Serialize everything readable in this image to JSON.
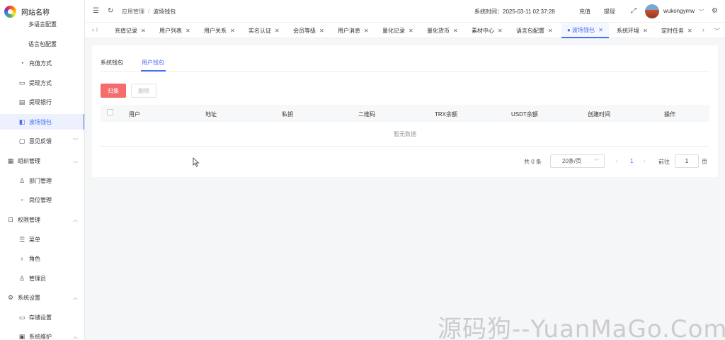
{
  "logo": {
    "text": "网站名称"
  },
  "sidebar": {
    "items": [
      {
        "label": "多语言配置"
      },
      {
        "label": "语言包配置"
      },
      {
        "label": "充值方式"
      },
      {
        "label": "提现方式"
      },
      {
        "label": "提现银行"
      },
      {
        "label": "波场钱包"
      },
      {
        "label": "意见反馈"
      },
      {
        "label": "组织管理"
      },
      {
        "label": "部门管理"
      },
      {
        "label": "岗位管理"
      },
      {
        "label": "权限管理"
      },
      {
        "label": "菜单"
      },
      {
        "label": "角色"
      },
      {
        "label": "管理员"
      },
      {
        "label": "系统设置"
      },
      {
        "label": "存储设置"
      },
      {
        "label": "系统维护"
      }
    ]
  },
  "header": {
    "breadcrumb": [
      "应用管理",
      "波场钱包"
    ],
    "system_time": "系统时间：2025-03-11 02:37:28",
    "recharge_label": "充值",
    "withdraw_label": "提现",
    "username": "wukongymw"
  },
  "tabs": [
    {
      "label": "充值记录"
    },
    {
      "label": "用户列表"
    },
    {
      "label": "用户关系"
    },
    {
      "label": "实名认证"
    },
    {
      "label": "会员等级"
    },
    {
      "label": "用户消息"
    },
    {
      "label": "量化记录"
    },
    {
      "label": "量化货币"
    },
    {
      "label": "素材中心"
    },
    {
      "label": "语言包配置"
    },
    {
      "label": "● 波场钱包"
    },
    {
      "label": "系统环境"
    },
    {
      "label": "定时任务"
    }
  ],
  "main": {
    "subtabs": [
      {
        "label": "系统钱包"
      },
      {
        "label": "用户钱包"
      }
    ],
    "collect_label": "归集",
    "delete_label": "删除",
    "columns": [
      "用户",
      "地址",
      "私钥",
      "二维码",
      "TRX余额",
      "USDT余额",
      "创建时间",
      "操作"
    ],
    "empty_text": "暂无数据",
    "pagination": {
      "total": "共 0 条",
      "page_size": "20条/页",
      "current_page": "1",
      "goto_label": "前往",
      "goto_value": "1",
      "page_unit": "页"
    }
  },
  "watermark": "源码狗--YuanMaGo.Com"
}
